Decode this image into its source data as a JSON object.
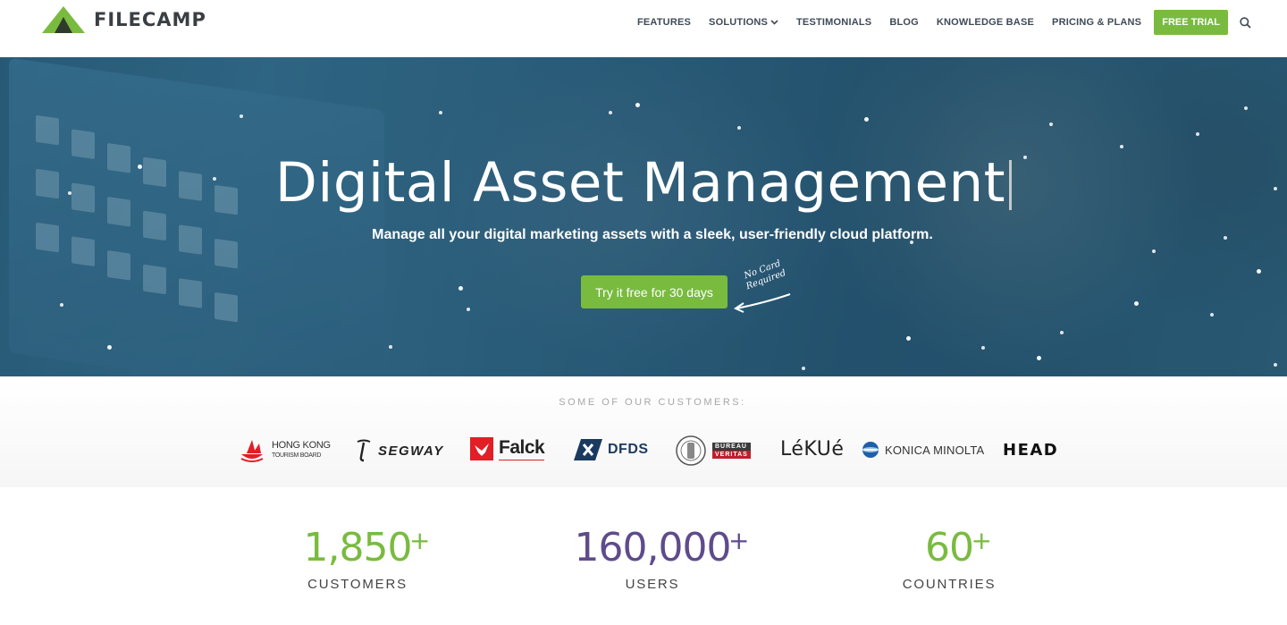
{
  "brand": {
    "name": "FILECAMP",
    "accent": "#79bb3f",
    "purple": "#5f4b8b"
  },
  "nav": {
    "items": [
      {
        "label": "FEATURES"
      },
      {
        "label": "SOLUTIONS"
      },
      {
        "label": "TESTIMONIALS"
      },
      {
        "label": "BLOG"
      },
      {
        "label": "KNOWLEDGE BASE"
      },
      {
        "label": "PRICING & PLANS"
      }
    ],
    "cta": "FREE TRIAL",
    "search_icon": "search-icon"
  },
  "hero": {
    "title": "Digital Asset Management",
    "subtitle": "Manage all your digital marketing assets with a sleek, user-friendly cloud platform.",
    "button": "Try it free for 30 days",
    "note_line1": "No Card",
    "note_line2": "Required"
  },
  "customers": {
    "title": "SOME OF OUR CUSTOMERS:",
    "logos": {
      "hk_line1": "HONG KONG",
      "hk_line2": "TOURISM BOARD",
      "segway": "SEGWAY",
      "falck": "Falck",
      "dfds": "DFDS",
      "bv_top": "BUREAU",
      "bv_bottom": "VERITAS",
      "lekue": "LéKUé",
      "konica": "KONICA MINOLTA",
      "head": "HEAD"
    }
  },
  "stats": [
    {
      "value": "1,850",
      "suffix": "+",
      "label": "CUSTOMERS",
      "color": "#79bb3f"
    },
    {
      "value": "160,000",
      "suffix": "+",
      "label": "USERS",
      "color": "#5f4b8b"
    },
    {
      "value": "60",
      "suffix": "+",
      "label": "COUNTRIES",
      "color": "#79bb3f"
    }
  ]
}
